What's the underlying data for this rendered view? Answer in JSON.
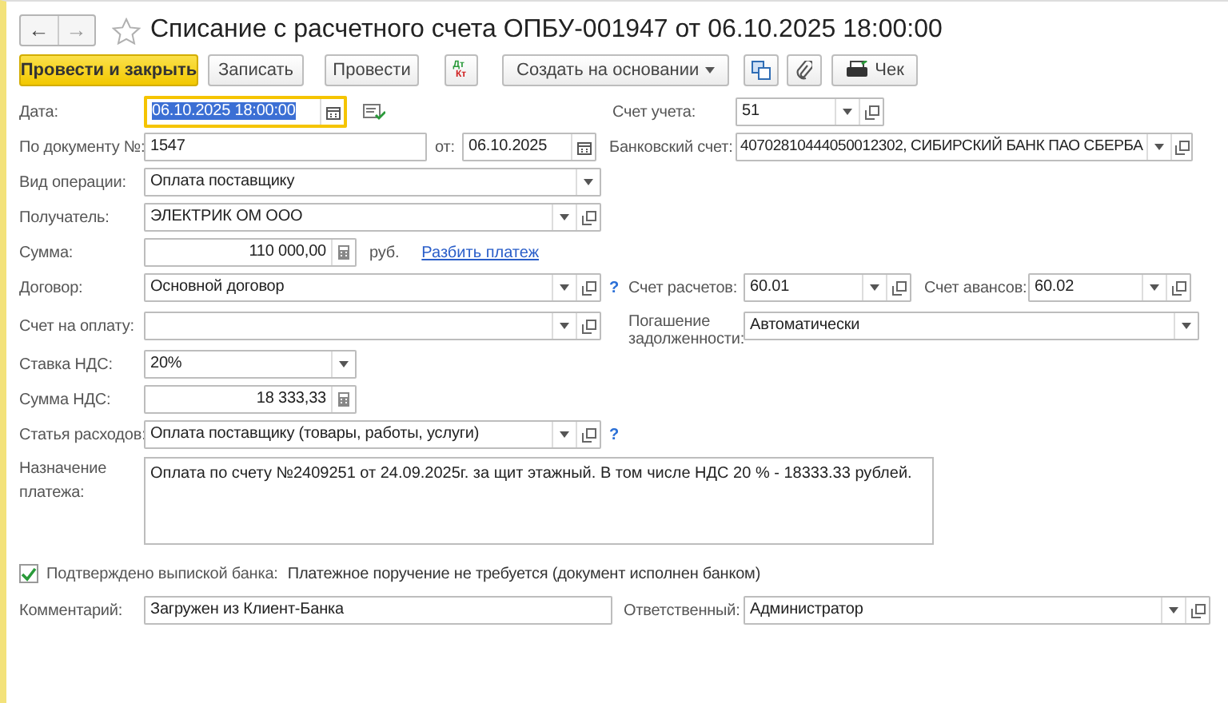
{
  "nav": {
    "back": "←",
    "forward": "→"
  },
  "favorite": false,
  "title": "Списание с расчетного счета ОПБУ-001947 от 06.10.2025 18:00:00",
  "toolbar": [
    {
      "kind": "primary",
      "label": "Провести и закрыть"
    },
    {
      "kind": "button",
      "label": "Записать"
    },
    {
      "kind": "button",
      "label": "Провести"
    },
    {
      "kind": "dtkt",
      "label": "Дт",
      "label2": "Кт"
    },
    {
      "kind": "dropdown",
      "label": "Создать на основании"
    },
    {
      "kind": "structure"
    },
    {
      "kind": "attach"
    },
    {
      "kind": "print",
      "label": "Чек"
    }
  ],
  "date": {
    "label": "Дата:",
    "value": "06.10.2025 18:00:00",
    "focused": true
  },
  "account": {
    "label": "Счет учета:",
    "value": "51"
  },
  "doc_number": {
    "label": "По документу №:",
    "value": "1547"
  },
  "doc_date": {
    "label": "от:",
    "value": "06.10.2025"
  },
  "bank_account": {
    "label": "Банковский счет:",
    "value": "40702810444050012302, СИБИРСКИЙ БАНК ПАО СБЕРБА"
  },
  "operation": {
    "label": "Вид операции:",
    "value": "Оплата поставщику"
  },
  "recipient": {
    "label": "Получатель:",
    "value": "ЭЛЕКТРИК ОМ ООО"
  },
  "amount": {
    "label": "Сумма:",
    "value": "110 000,00",
    "currency": "руб.",
    "link": "Разбить платеж"
  },
  "contract": {
    "label": "Договор:",
    "value": "Основной договор",
    "help": "?"
  },
  "settlement_account": {
    "label": "Счет расчетов:",
    "value": "60.01"
  },
  "advance_account": {
    "label": "Счет авансов:",
    "value": "60.02"
  },
  "invoice": {
    "label": "Счет на оплату:"
  },
  "debt_repayment": {
    "label": "Погашение задолженности:",
    "value": "Автоматически"
  },
  "vat_rate": {
    "label": "Ставка НДС:",
    "value": "20%"
  },
  "vat_amount": {
    "label": "Сумма НДС:",
    "value": "18 333,33"
  },
  "expense_item": {
    "label": "Статья расходов:",
    "value": "Оплата поставщику (товары, работы, услуги)",
    "help": "?"
  },
  "purpose": {
    "label": "Назначение платежа:",
    "value": "Оплата по счету №2409251 от 24.09.2025г. за щит этажный. В том числе НДС 20 % - 18333.33 рублей."
  },
  "bank_confirmed": {
    "label": "Подтверждено выпиской банка:",
    "checked": true,
    "note": "Платежное поручение не требуется (документ исполнен банком)"
  },
  "comment": {
    "label": "Комментарий:",
    "value": "Загружен из Клиент-Банка"
  },
  "responsible": {
    "label": "Ответственный:",
    "value": "Администратор"
  }
}
